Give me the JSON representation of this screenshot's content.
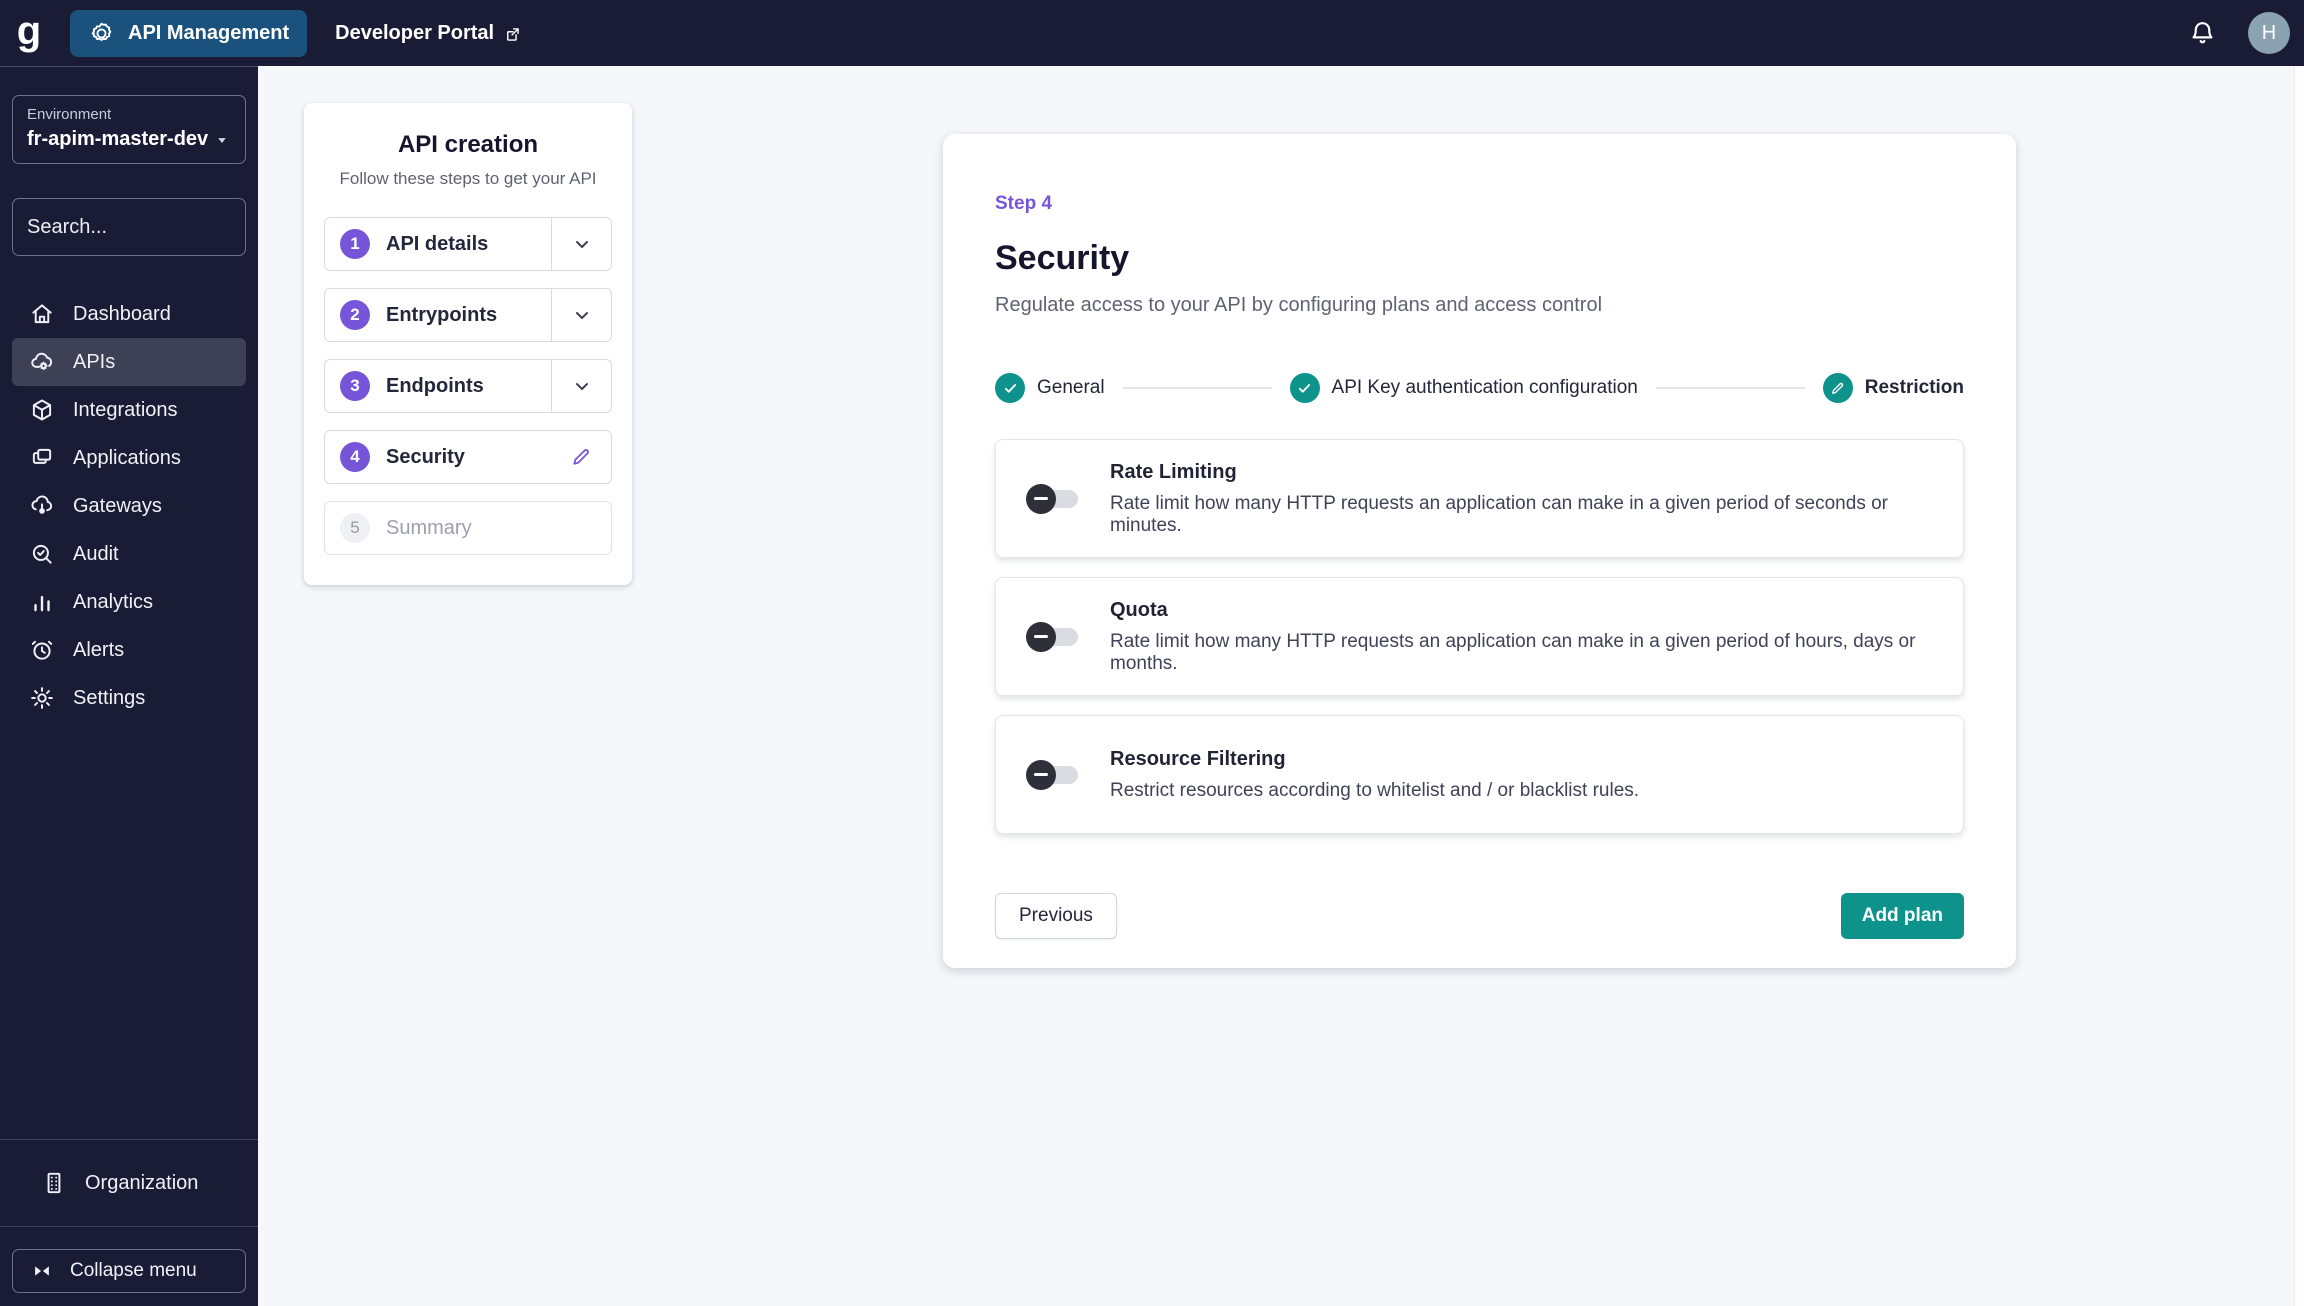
{
  "topbar": {
    "logo_letter": "g",
    "api_management_label": "API Management",
    "developer_portal_label": "Developer Portal",
    "avatar_initial": "H"
  },
  "sidebar": {
    "environment_label": "Environment",
    "environment_value": "fr-apim-master-dev",
    "search_placeholder": "Search...",
    "items": [
      {
        "label": "Dashboard",
        "icon": "home-icon",
        "selected": false
      },
      {
        "label": "APIs",
        "icon": "cloud-gear-icon",
        "selected": true
      },
      {
        "label": "Integrations",
        "icon": "cube-icon",
        "selected": false
      },
      {
        "label": "Applications",
        "icon": "windows-icon",
        "selected": false
      },
      {
        "label": "Gateways",
        "icon": "cloud-node-icon",
        "selected": false
      },
      {
        "label": "Audit",
        "icon": "magnifier-check-icon",
        "selected": false
      },
      {
        "label": "Analytics",
        "icon": "bar-chart-icon",
        "selected": false
      },
      {
        "label": "Alerts",
        "icon": "alarm-clock-icon",
        "selected": false
      },
      {
        "label": "Settings",
        "icon": "gear-icon",
        "selected": false
      }
    ],
    "organization_label": "Organization",
    "collapse_label": "Collapse menu"
  },
  "wizard": {
    "title": "API creation",
    "subtitle": "Follow these steps to get your API",
    "steps": [
      {
        "number": "1",
        "label": "API details",
        "state": "collapsed"
      },
      {
        "number": "2",
        "label": "Entrypoints",
        "state": "collapsed"
      },
      {
        "number": "3",
        "label": "Endpoints",
        "state": "collapsed"
      },
      {
        "number": "4",
        "label": "Security",
        "state": "editing"
      },
      {
        "number": "5",
        "label": "Summary",
        "state": "disabled"
      }
    ]
  },
  "main": {
    "step_tag": "Step 4",
    "title": "Security",
    "description": "Regulate access to your API by configuring plans and access control",
    "stepper": [
      {
        "label": "General",
        "state": "done"
      },
      {
        "label": "API Key authentication configuration",
        "state": "done"
      },
      {
        "label": "Restriction",
        "state": "current"
      }
    ],
    "options": [
      {
        "title": "Rate Limiting",
        "enabled": false,
        "description": "Rate limit how many HTTP requests an application can make in a given period of seconds or minutes."
      },
      {
        "title": "Quota",
        "enabled": false,
        "description": "Rate limit how many HTTP requests an application can make in a given period of hours, days or months."
      },
      {
        "title": "Resource Filtering",
        "enabled": false,
        "description": "Restrict resources according to whitelist and / or blacklist rules."
      }
    ],
    "previous_label": "Previous",
    "add_plan_label": "Add plan"
  },
  "colors": {
    "topbar_bg": "#1A1C36",
    "apim_button_blue": "#1B527D",
    "accent_purple": "#7655D9",
    "accent_teal": "#0D938C",
    "avatar_bg": "#8BA2B1",
    "main_bg": "#F6F7FA"
  }
}
